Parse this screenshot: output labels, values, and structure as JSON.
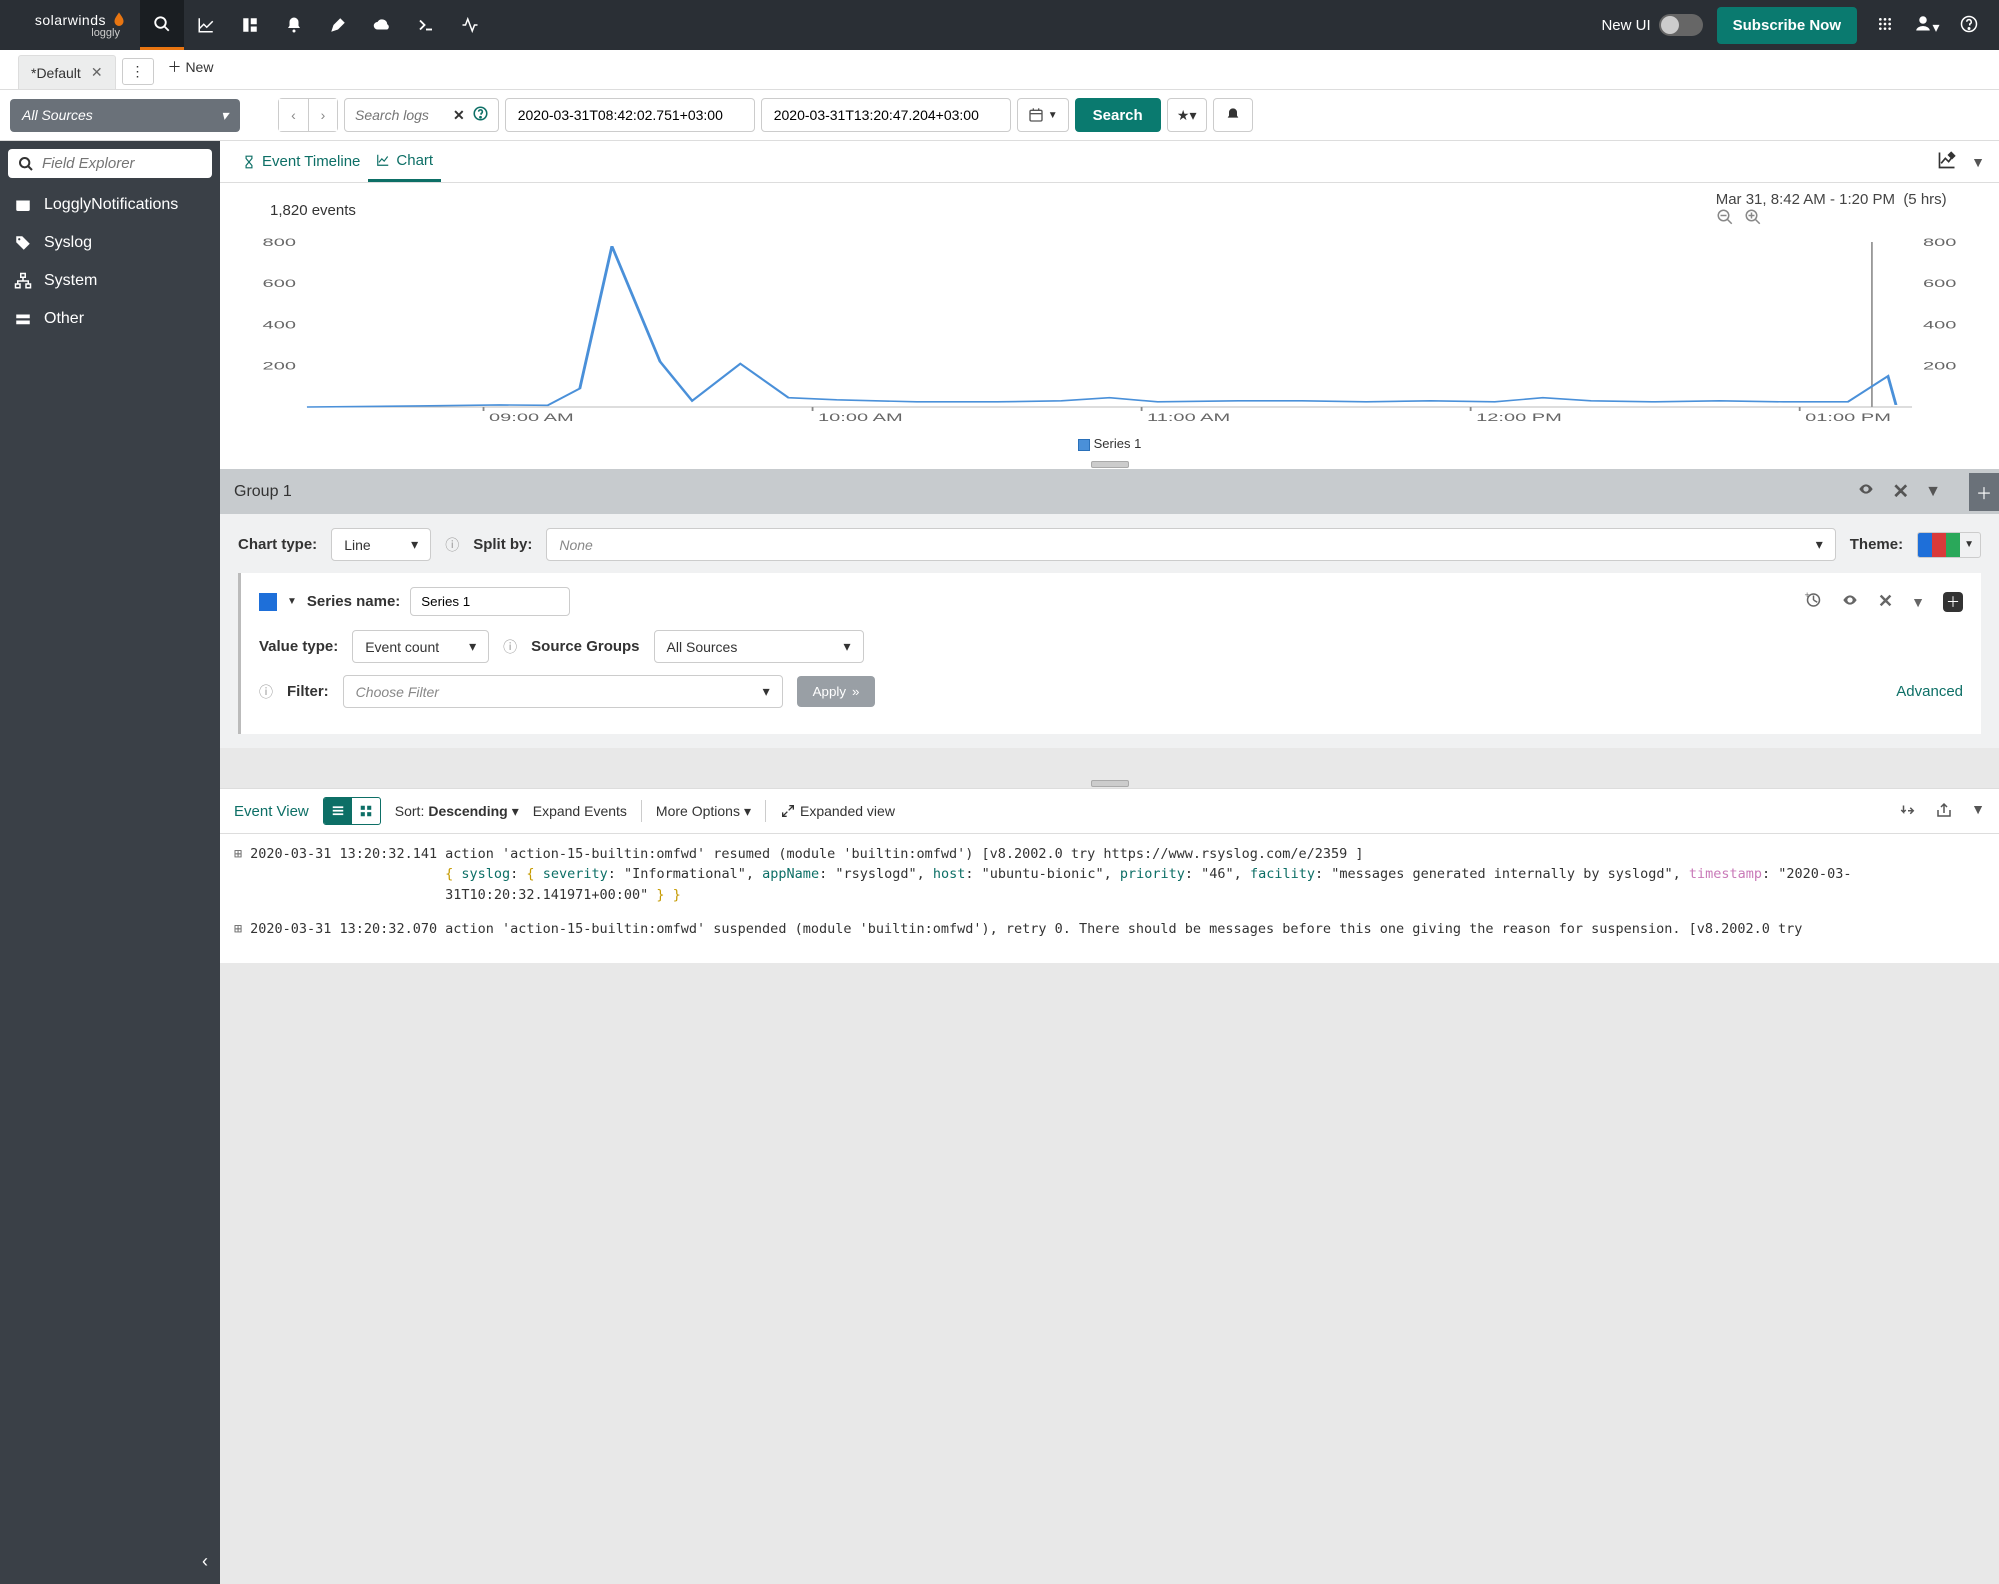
{
  "brand": {
    "name": "solarwinds",
    "sub": "loggly"
  },
  "topnav": {
    "new_ui": "New UI",
    "subscribe": "Subscribe Now"
  },
  "tabs": {
    "default": "*Default",
    "new": "New"
  },
  "search": {
    "sources": "All Sources",
    "placeholder": "Search logs",
    "from": "2020-03-31T08:42:02.751+03:00",
    "to": "2020-03-31T13:20:47.204+03:00",
    "button": "Search"
  },
  "sidebar": {
    "field_placeholder": "Field Explorer",
    "items": [
      "LogglyNotifications",
      "Syslog",
      "System",
      "Other"
    ]
  },
  "chart_tabs": {
    "timeline": "Event Timeline",
    "chart": "Chart"
  },
  "chart_header": {
    "count": "1,820 events",
    "range": "Mar 31, 8:42 AM - 1:20 PM",
    "duration": "(5 hrs)"
  },
  "chart_data": {
    "type": "line",
    "ylim": [
      0,
      800
    ],
    "yticks": [
      200,
      400,
      600,
      800
    ],
    "xticks": [
      "09:00 AM",
      "10:00 AM",
      "11:00 AM",
      "12:00 PM",
      "01:00 PM"
    ],
    "series": [
      {
        "name": "Series 1",
        "color": "#4a90d9",
        "points": [
          [
            0.0,
            0
          ],
          [
            0.07,
            5
          ],
          [
            0.12,
            10
          ],
          [
            0.15,
            8
          ],
          [
            0.17,
            90
          ],
          [
            0.19,
            780
          ],
          [
            0.22,
            220
          ],
          [
            0.24,
            30
          ],
          [
            0.27,
            210
          ],
          [
            0.3,
            45
          ],
          [
            0.33,
            35
          ],
          [
            0.38,
            25
          ],
          [
            0.43,
            25
          ],
          [
            0.47,
            30
          ],
          [
            0.5,
            45
          ],
          [
            0.53,
            25
          ],
          [
            0.58,
            30
          ],
          [
            0.62,
            30
          ],
          [
            0.66,
            25
          ],
          [
            0.7,
            30
          ],
          [
            0.74,
            25
          ],
          [
            0.77,
            45
          ],
          [
            0.8,
            30
          ],
          [
            0.84,
            25
          ],
          [
            0.88,
            30
          ],
          [
            0.92,
            25
          ],
          [
            0.96,
            25
          ],
          [
            0.985,
            150
          ],
          [
            0.99,
            10
          ]
        ]
      }
    ],
    "legend": "Series 1"
  },
  "group": {
    "title": "Group 1",
    "chart_type_lbl": "Chart type:",
    "chart_type": "Line",
    "split_lbl": "Split by:",
    "split_val": "None",
    "theme_lbl": "Theme:",
    "series_name_lbl": "Series name:",
    "series_name": "Series 1",
    "value_type_lbl": "Value type:",
    "value_type": "Event count",
    "source_groups_lbl": "Source Groups",
    "source_groups": "All Sources",
    "filter_lbl": "Filter:",
    "filter_ph": "Choose Filter",
    "apply": "Apply",
    "advanced": "Advanced"
  },
  "events_toolbar": {
    "label": "Event View",
    "sort_lbl": "Sort:",
    "sort_val": "Descending",
    "expand": "Expand Events",
    "more": "More Options",
    "expanded_view": "Expanded view"
  },
  "events": [
    {
      "ts": "2020-03-31 13:20:32.141",
      "msg": "action 'action-15-builtin:omfwd' resumed (module 'builtin:omfwd') [v8.2002.0 try https://www.rsyslog.com/e/2359 ]",
      "json_parts": [
        {
          "k": "severity",
          "v": "\"Informational\""
        },
        {
          "k": "appName",
          "v": "\"rsyslogd\""
        },
        {
          "k": "host",
          "v": "\"ubuntu-bionic\""
        },
        {
          "k": "priority",
          "v": "\"46\""
        },
        {
          "k": "facility",
          "v": "\"messages generated internally by syslogd\""
        },
        {
          "k": "timestamp",
          "v": "\"2020-03-31T10:20:32.141971+00:00\"",
          "ts": true
        }
      ]
    },
    {
      "ts": "2020-03-31 13:20:32.070",
      "msg": "action 'action-15-builtin:omfwd' suspended (module 'builtin:omfwd'), retry 0. There should be messages before this one giving the reason for suspension. [v8.2002.0 try"
    }
  ]
}
